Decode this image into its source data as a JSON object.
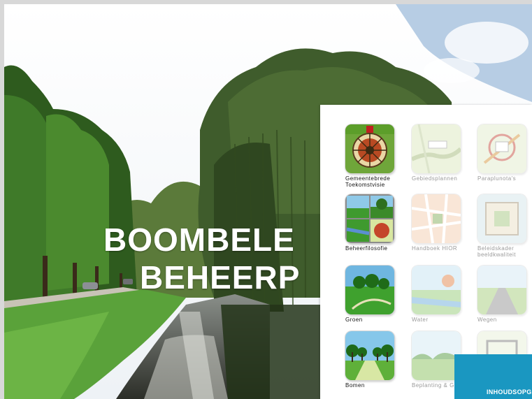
{
  "cover": {
    "title_line1": "BOOMBELE",
    "title_line2": "BEHEERP"
  },
  "menu": {
    "items": [
      {
        "id": "gemeentebrede",
        "label": "Gemeentebrede Toekomstvisie",
        "active": true,
        "icon": "compass-icon"
      },
      {
        "id": "gebiedsplannen",
        "label": "Gebiedsplannen",
        "active": false,
        "icon": "map-icon"
      },
      {
        "id": "paraplunota",
        "label": "Paraplunota's",
        "active": false,
        "icon": "map-plan-icon"
      },
      {
        "id": "beheerfilosofie",
        "label": "Beheerfilosofie",
        "active": true,
        "icon": "landscape-grid-icon"
      },
      {
        "id": "handboek",
        "label": "Handboek HIOR",
        "active": false,
        "icon": "street-map-icon"
      },
      {
        "id": "beleidskader",
        "label": "Beleidskader beeldkwaliteit",
        "active": false,
        "icon": "square-plan-icon"
      },
      {
        "id": "groen",
        "label": "Groen",
        "active": true,
        "icon": "park-icon"
      },
      {
        "id": "water",
        "label": "Water",
        "active": false,
        "icon": "water-icon"
      },
      {
        "id": "wegen",
        "label": "Wegen",
        "active": false,
        "icon": "road-icon"
      },
      {
        "id": "bomen",
        "label": "Bomen",
        "active": true,
        "icon": "tree-lane-icon"
      },
      {
        "id": "beplanting",
        "label": "Beplanting & Gras",
        "active": false,
        "icon": "planting-icon"
      },
      {
        "id": "extra",
        "label": "",
        "active": false,
        "icon": "fence-icon"
      }
    ],
    "toc_button": "INHOUDSOPGAVE"
  },
  "colors": {
    "accent": "#1a97c1",
    "icon_green": "#3a9a2e",
    "icon_frame": "#8d8d8d"
  }
}
